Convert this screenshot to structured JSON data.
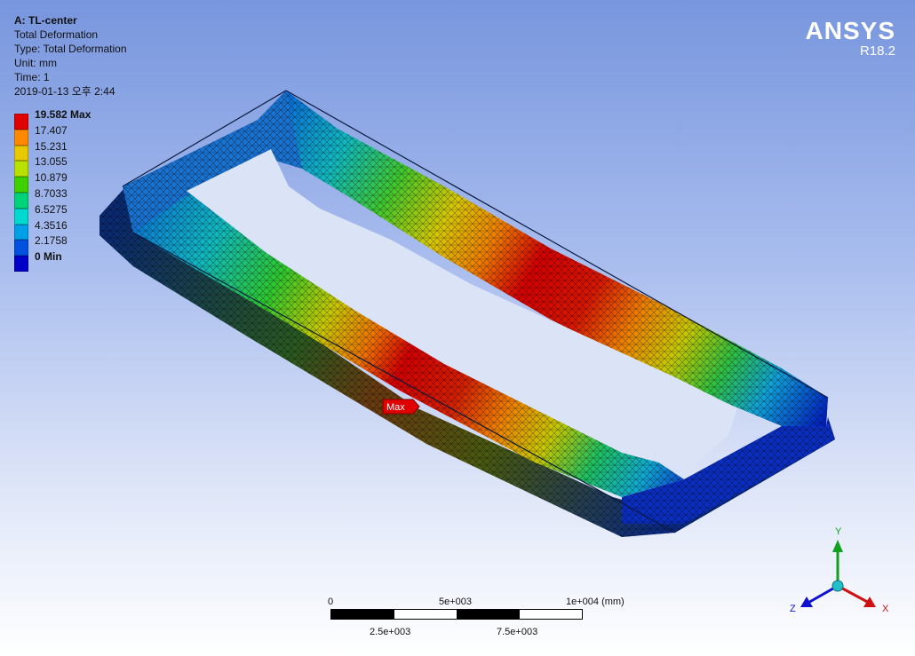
{
  "info": {
    "title": "A: TL-center",
    "line1": "Total Deformation",
    "line2": "Type: Total Deformation",
    "line3": "Unit: mm",
    "line4": "Time: 1",
    "line5": "2019-01-13 오후 2:44"
  },
  "legend": [
    {
      "label": "19.582 Max",
      "color": "#e00000"
    },
    {
      "label": "17.407",
      "color": "#ff8a00"
    },
    {
      "label": "15.231",
      "color": "#e8c800"
    },
    {
      "label": "13.055",
      "color": "#b8e000"
    },
    {
      "label": "10.879",
      "color": "#3fd000"
    },
    {
      "label": "8.7033",
      "color": "#00d27a"
    },
    {
      "label": "6.5275",
      "color": "#00d8d0"
    },
    {
      "label": "4.3516",
      "color": "#00a0e8"
    },
    {
      "label": "2.1758",
      "color": "#0050e0"
    },
    {
      "label": "0 Min",
      "color": "#0000c8"
    }
  ],
  "brand": {
    "name": "ANSYS",
    "version": "R18.2"
  },
  "probe": {
    "label": "Max"
  },
  "scale_bar": {
    "top_labels": [
      "0",
      "5e+003",
      "1e+004 (mm)"
    ],
    "bottom_labels": [
      "2.5e+003",
      "7.5e+003"
    ]
  },
  "triad": {
    "x": "X",
    "y": "Y",
    "z": "Z"
  }
}
